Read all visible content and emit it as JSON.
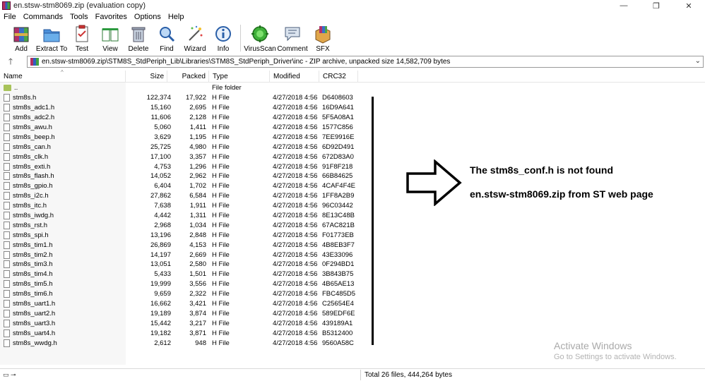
{
  "window": {
    "title": "en.stsw-stm8069.zip (evaluation copy)",
    "minimize": "—",
    "maximize": "❐",
    "close": "✕"
  },
  "menu": [
    "File",
    "Commands",
    "Tools",
    "Favorites",
    "Options",
    "Help"
  ],
  "toolbar": [
    {
      "label": "Add",
      "icon": "add-archive-icon"
    },
    {
      "label": "Extract To",
      "icon": "extract-folder-icon"
    },
    {
      "label": "Test",
      "icon": "test-clipboard-icon"
    },
    {
      "label": "View",
      "icon": "view-book-icon"
    },
    {
      "label": "Delete",
      "icon": "trash-icon"
    },
    {
      "label": "Find",
      "icon": "magnifier-icon"
    },
    {
      "label": "Wizard",
      "icon": "wand-icon"
    },
    {
      "label": "Info",
      "icon": "info-icon"
    },
    {
      "label": "VirusScan",
      "icon": "virus-scan-icon"
    },
    {
      "label": "Comment",
      "icon": "comment-icon"
    },
    {
      "label": "SFX",
      "icon": "sfx-box-icon"
    }
  ],
  "address": {
    "up": "🡑",
    "path": "en.stsw-stm8069.zip\\STM8S_StdPeriph_Lib\\Libraries\\STM8S_StdPeriph_Driver\\inc - ZIP archive, unpacked size 14,582,709 bytes",
    "dropdown": "⌄"
  },
  "columns": {
    "name": "Name",
    "size": "Size",
    "packed": "Packed",
    "type": "Type",
    "modified": "Modified",
    "crc": "CRC32",
    "sort_indicator": "^"
  },
  "files": [
    {
      "name": "..",
      "size": "",
      "packed": "",
      "type": "File folder",
      "modified": "",
      "crc": "",
      "folder": true
    },
    {
      "name": "stm8s.h",
      "size": "122,374",
      "packed": "17,922",
      "type": "H File",
      "modified": "4/27/2018 4:56 ...",
      "crc": "D6408603"
    },
    {
      "name": "stm8s_adc1.h",
      "size": "15,160",
      "packed": "2,695",
      "type": "H File",
      "modified": "4/27/2018 4:56 ...",
      "crc": "16D9A641"
    },
    {
      "name": "stm8s_adc2.h",
      "size": "11,606",
      "packed": "2,128",
      "type": "H File",
      "modified": "4/27/2018 4:56 ...",
      "crc": "5F5A08A1"
    },
    {
      "name": "stm8s_awu.h",
      "size": "5,060",
      "packed": "1,411",
      "type": "H File",
      "modified": "4/27/2018 4:56 ...",
      "crc": "1577C856"
    },
    {
      "name": "stm8s_beep.h",
      "size": "3,629",
      "packed": "1,195",
      "type": "H File",
      "modified": "4/27/2018 4:56 ...",
      "crc": "7EE9916E"
    },
    {
      "name": "stm8s_can.h",
      "size": "25,725",
      "packed": "4,980",
      "type": "H File",
      "modified": "4/27/2018 4:56 ...",
      "crc": "6D92D491"
    },
    {
      "name": "stm8s_clk.h",
      "size": "17,100",
      "packed": "3,357",
      "type": "H File",
      "modified": "4/27/2018 4:56 ...",
      "crc": "672D83A0"
    },
    {
      "name": "stm8s_exti.h",
      "size": "4,753",
      "packed": "1,296",
      "type": "H File",
      "modified": "4/27/2018 4:56 ...",
      "crc": "91F8F218"
    },
    {
      "name": "stm8s_flash.h",
      "size": "14,052",
      "packed": "2,962",
      "type": "H File",
      "modified": "4/27/2018 4:56 ...",
      "crc": "66B84625"
    },
    {
      "name": "stm8s_gpio.h",
      "size": "6,404",
      "packed": "1,702",
      "type": "H File",
      "modified": "4/27/2018 4:56 ...",
      "crc": "4CAF4F4E"
    },
    {
      "name": "stm8s_i2c.h",
      "size": "27,862",
      "packed": "6,584",
      "type": "H File",
      "modified": "4/27/2018 4:56 ...",
      "crc": "1FF8A2B9"
    },
    {
      "name": "stm8s_itc.h",
      "size": "7,638",
      "packed": "1,911",
      "type": "H File",
      "modified": "4/27/2018 4:56 ...",
      "crc": "96C03442"
    },
    {
      "name": "stm8s_iwdg.h",
      "size": "4,442",
      "packed": "1,311",
      "type": "H File",
      "modified": "4/27/2018 4:56 ...",
      "crc": "8E13C48B"
    },
    {
      "name": "stm8s_rst.h",
      "size": "2,968",
      "packed": "1,034",
      "type": "H File",
      "modified": "4/27/2018 4:56 ...",
      "crc": "67AC821B"
    },
    {
      "name": "stm8s_spi.h",
      "size": "13,196",
      "packed": "2,848",
      "type": "H File",
      "modified": "4/27/2018 4:56 ...",
      "crc": "F01773EB"
    },
    {
      "name": "stm8s_tim1.h",
      "size": "26,869",
      "packed": "4,153",
      "type": "H File",
      "modified": "4/27/2018 4:56 ...",
      "crc": "4B8EB3F7"
    },
    {
      "name": "stm8s_tim2.h",
      "size": "14,197",
      "packed": "2,669",
      "type": "H File",
      "modified": "4/27/2018 4:56 ...",
      "crc": "43E33096"
    },
    {
      "name": "stm8s_tim3.h",
      "size": "13,051",
      "packed": "2,580",
      "type": "H File",
      "modified": "4/27/2018 4:56 ...",
      "crc": "0F294BD1"
    },
    {
      "name": "stm8s_tim4.h",
      "size": "5,433",
      "packed": "1,501",
      "type": "H File",
      "modified": "4/27/2018 4:56 ...",
      "crc": "3B843B75"
    },
    {
      "name": "stm8s_tim5.h",
      "size": "19,999",
      "packed": "3,556",
      "type": "H File",
      "modified": "4/27/2018 4:56 ...",
      "crc": "4B65AE13"
    },
    {
      "name": "stm8s_tim6.h",
      "size": "9,659",
      "packed": "2,322",
      "type": "H File",
      "modified": "4/27/2018 4:56 ...",
      "crc": "FBC485D5"
    },
    {
      "name": "stm8s_uart1.h",
      "size": "16,662",
      "packed": "3,421",
      "type": "H File",
      "modified": "4/27/2018 4:56 ...",
      "crc": "C25654E4"
    },
    {
      "name": "stm8s_uart2.h",
      "size": "19,189",
      "packed": "3,874",
      "type": "H File",
      "modified": "4/27/2018 4:56 ...",
      "crc": "589EDF6E"
    },
    {
      "name": "stm8s_uart3.h",
      "size": "15,442",
      "packed": "3,217",
      "type": "H File",
      "modified": "4/27/2018 4:56 ...",
      "crc": "439189A1"
    },
    {
      "name": "stm8s_uart4.h",
      "size": "19,182",
      "packed": "3,871",
      "type": "H File",
      "modified": "4/27/2018 4:56 ...",
      "crc": "B5312400"
    },
    {
      "name": "stm8s_wwdg.h",
      "size": "2,612",
      "packed": "948",
      "type": "H File",
      "modified": "4/27/2018 4:56 ...",
      "crc": "9560A58C"
    }
  ],
  "annotation": {
    "line1": "The stm8s_conf.h is not found",
    "line2": "en.stsw-stm8069.zip from ST web page"
  },
  "watermark": {
    "title": "Activate Windows",
    "subtitle": "Go to Settings to activate Windows."
  },
  "status": {
    "left_icons": "▭ ⊸",
    "text": "Total 26 files, 444,264 bytes"
  }
}
